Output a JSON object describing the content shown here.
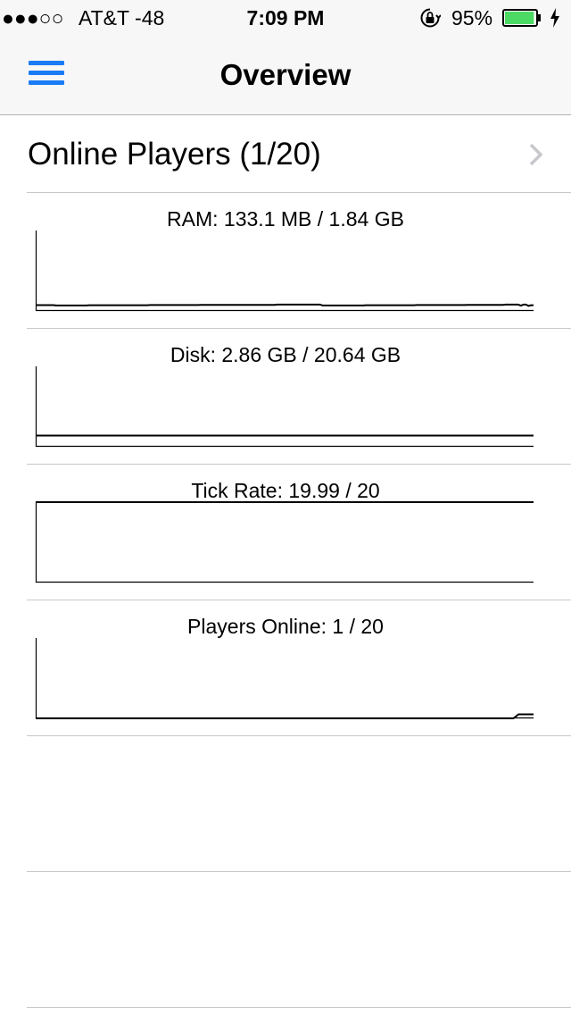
{
  "status_bar": {
    "signal": "●●●○○",
    "carrier": "AT&T  -48",
    "time": "7:09 PM",
    "battery_percent": "95%",
    "battery_level": 0.95,
    "battery_color": "#4cd964",
    "icons": [
      "orientation-lock-icon",
      "battery-icon",
      "charging-bolt-icon"
    ]
  },
  "nav": {
    "title": "Overview",
    "menu_icon": "hamburger-menu-icon",
    "accent": "#1a7cf5"
  },
  "players_row": {
    "label": "Online Players (1/20)",
    "chevron_icon": "chevron-right-icon"
  },
  "stats": [
    {
      "title": "RAM: 133.1 MB / 1.84 GB"
    },
    {
      "title": "Disk: 2.86 GB / 20.64 GB"
    },
    {
      "title": "Tick Rate: 19.99 / 20"
    },
    {
      "title": "Players Online: 1 / 20"
    }
  ],
  "chart_data": [
    {
      "type": "line",
      "title": "RAM: 133.1 MB / 1.84 GB",
      "ylim": [
        0,
        1.84
      ],
      "values": [
        0.133,
        0.133,
        0.133,
        0.133,
        0.133,
        0.133,
        0.133,
        0.133,
        0.125,
        0.125,
        0.125,
        0.125,
        0.125,
        0.125,
        0.125,
        0.125,
        0.125,
        0.125,
        0.125,
        0.125,
        0.125,
        0.13,
        0.13,
        0.13,
        0.13,
        0.13,
        0.13,
        0.13,
        0.13,
        0.13,
        0.13,
        0.13,
        0.13,
        0.13,
        0.13,
        0.13,
        0.13,
        0.13,
        0.13,
        0.13,
        0.13,
        0.13,
        0.13,
        0.13,
        0.13,
        0.135,
        0.135,
        0.135,
        0.135,
        0.135,
        0.135,
        0.135,
        0.135,
        0.135,
        0.135,
        0.135,
        0.135,
        0.135,
        0.135,
        0.135,
        0.135,
        0.135,
        0.135,
        0.135,
        0.135,
        0.14,
        0.14,
        0.14,
        0.14,
        0.14,
        0.14,
        0.14,
        0.14,
        0.14,
        0.14,
        0.14,
        0.14,
        0.14,
        0.14,
        0.14,
        0.14,
        0.14,
        0.14,
        0.14,
        0.14,
        0.14,
        0.14,
        0.14,
        0.14,
        0.14,
        0.14,
        0.14,
        0.14,
        0.14,
        0.14,
        0.145,
        0.145,
        0.145,
        0.145,
        0.145,
        0.145,
        0.145,
        0.145,
        0.145,
        0.145,
        0.145,
        0.145,
        0.145,
        0.145,
        0.145,
        0.145,
        0.145,
        0.145,
        0.125,
        0.125,
        0.125,
        0.125,
        0.125,
        0.125,
        0.125,
        0.125,
        0.125,
        0.125,
        0.125,
        0.125,
        0.125,
        0.125,
        0.125,
        0.125,
        0.125,
        0.13,
        0.13,
        0.13,
        0.13,
        0.13,
        0.13,
        0.13,
        0.13,
        0.13,
        0.13,
        0.13,
        0.13,
        0.13,
        0.13,
        0.13,
        0.13,
        0.13,
        0.13,
        0.13,
        0.13,
        0.135,
        0.135,
        0.135,
        0.135,
        0.135,
        0.135,
        0.135,
        0.135,
        0.135,
        0.135,
        0.135,
        0.135,
        0.135,
        0.135,
        0.135,
        0.135,
        0.135,
        0.135,
        0.135,
        0.135,
        0.14,
        0.14,
        0.14,
        0.14,
        0.14,
        0.14,
        0.14,
        0.14,
        0.14,
        0.14,
        0.14,
        0.14,
        0.14,
        0.14,
        0.14,
        0.145,
        0.145,
        0.145,
        0.145,
        0.145,
        0.145,
        0.12,
        0.145,
        0.145,
        0.115,
        0.13,
        0.13
      ]
    },
    {
      "type": "line",
      "title": "Disk: 2.86 GB / 20.64 GB",
      "ylim": [
        0,
        20.64
      ],
      "values": [
        2.86,
        2.86,
        2.86,
        2.86,
        2.86,
        2.86,
        2.86,
        2.86,
        2.86,
        2.86,
        2.86,
        2.86,
        2.86,
        2.86,
        2.86,
        2.86,
        2.86,
        2.86,
        2.86,
        2.86
      ]
    },
    {
      "type": "line",
      "title": "Tick Rate: 19.99 / 20",
      "ylim": [
        0,
        20
      ],
      "values": [
        19.99,
        19.99,
        19.99,
        19.99,
        19.99,
        19.99,
        19.99,
        19.99,
        19.99,
        19.99,
        19.99,
        19.99,
        19.99,
        19.99,
        19.99,
        19.99,
        19.99,
        19.99,
        19.99,
        19.99
      ]
    },
    {
      "type": "line",
      "title": "Players Online: 1 / 20",
      "ylim": [
        0,
        20
      ],
      "values": [
        0,
        0,
        0,
        0,
        0,
        0,
        0,
        0,
        0,
        0,
        0,
        0,
        0,
        0,
        0,
        0,
        0,
        0,
        0,
        0,
        0,
        0,
        0,
        0,
        0,
        0,
        0,
        0,
        0,
        0,
        0,
        0,
        0,
        0,
        0,
        0,
        0,
        0,
        0,
        0,
        0,
        0,
        0,
        0,
        0,
        0,
        0,
        0,
        0,
        0,
        0,
        0,
        0,
        0,
        0,
        0,
        0,
        0,
        0,
        0,
        0,
        0,
        0,
        0,
        0,
        0,
        0,
        0,
        0,
        0,
        0,
        0,
        0,
        0,
        0,
        0,
        0,
        0,
        0,
        0,
        0,
        0,
        0,
        0,
        0,
        0,
        0,
        0,
        0,
        0,
        0,
        0,
        0,
        0,
        0,
        0,
        1,
        1,
        1,
        1
      ]
    }
  ]
}
